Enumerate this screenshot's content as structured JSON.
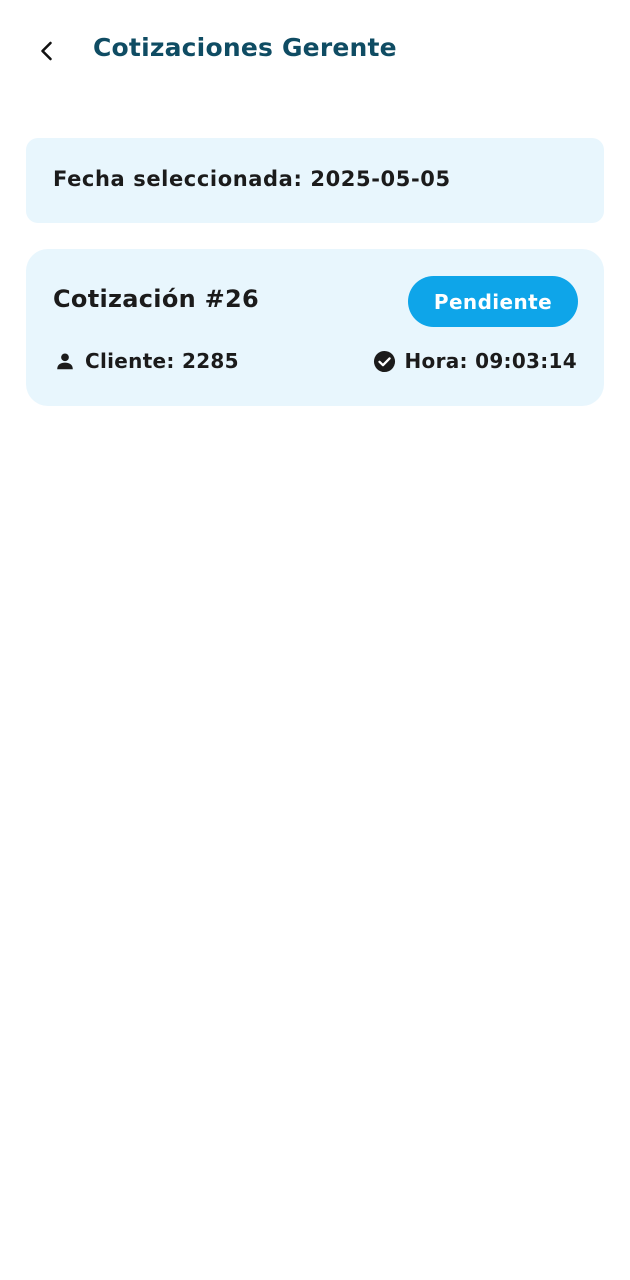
{
  "header": {
    "title": "Cotizaciones Gerente",
    "back_icon": "chevron-left-icon"
  },
  "date_banner": {
    "text": "Fecha seleccionada: 2025-05-05"
  },
  "quotes": [
    {
      "title": "Cotización #26",
      "status": "Pendiente",
      "client_icon": "person-icon",
      "client": "Cliente: 2285",
      "time_icon": "check-circle-icon",
      "time": "Hora: 09:03:14"
    }
  ],
  "colors": {
    "title": "#0f4c63",
    "card_background": "#e8f6fd",
    "badge": "#0ea5e9",
    "text": "#1b1b1b"
  }
}
